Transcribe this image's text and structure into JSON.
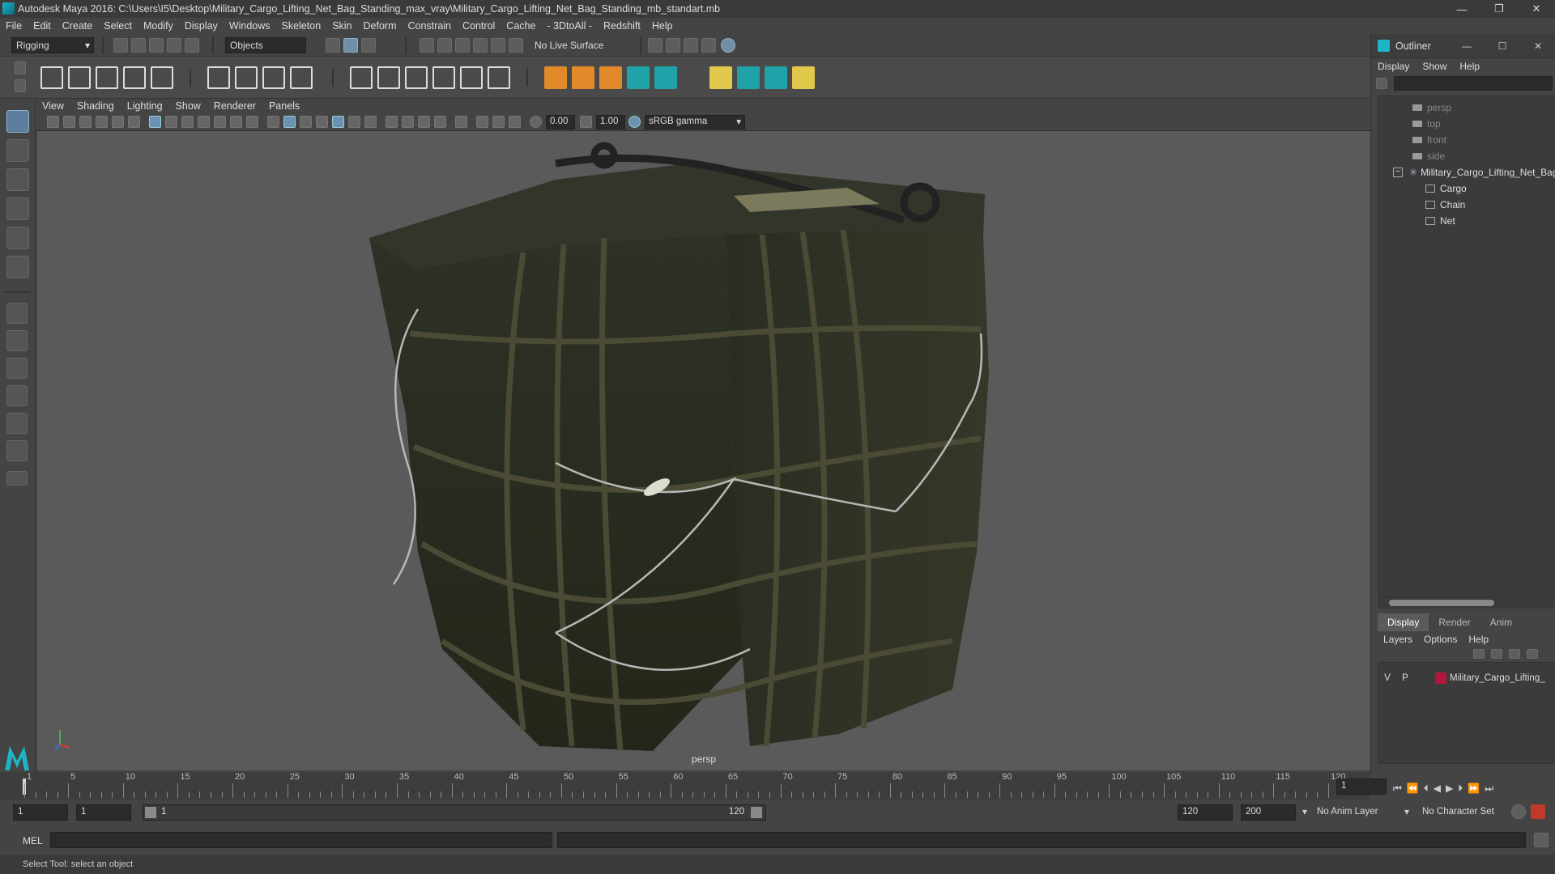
{
  "window": {
    "title": "Autodesk Maya 2016: C:\\Users\\I5\\Desktop\\Military_Cargo_Lifting_Net_Bag_Standing_max_vray\\Military_Cargo_Lifting_Net_Bag_Standing_mb_standart.mb"
  },
  "menubar": [
    "File",
    "Edit",
    "Create",
    "Select",
    "Modify",
    "Display",
    "Windows",
    "Skeleton",
    "Skin",
    "Deform",
    "Constrain",
    "Control",
    "Cache",
    "- 3DtoAll -",
    "Redshift",
    "Help"
  ],
  "status_line": {
    "mode": "Rigging",
    "select_mode": "Objects",
    "live_surface": "No Live Surface"
  },
  "viewport": {
    "menu": [
      "View",
      "Shading",
      "Lighting",
      "Show",
      "Renderer",
      "Panels"
    ],
    "exposure": "0.00",
    "gamma": "1.00",
    "color_space": "sRGB gamma",
    "camera_label": "persp"
  },
  "outliner": {
    "title": "Outliner",
    "menu": [
      "Display",
      "Show",
      "Help"
    ],
    "items": [
      {
        "label": "persp",
        "type": "camera"
      },
      {
        "label": "top",
        "type": "camera"
      },
      {
        "label": "front",
        "type": "camera"
      },
      {
        "label": "side",
        "type": "camera"
      },
      {
        "label": "Military_Cargo_Lifting_Net_Bag",
        "type": "group"
      },
      {
        "label": "Cargo",
        "type": "mesh"
      },
      {
        "label": "Chain",
        "type": "mesh"
      },
      {
        "label": "Net",
        "type": "mesh"
      }
    ]
  },
  "layer_editor": {
    "tabs": [
      "Display",
      "Render",
      "Anim"
    ],
    "menu": [
      "Layers",
      "Options",
      "Help"
    ],
    "layer": {
      "v": "V",
      "p": "P",
      "name": "Military_Cargo_Lifting_",
      "color": "#b0173d"
    }
  },
  "timeline": {
    "labels": [
      "1",
      "5",
      "10",
      "15",
      "20",
      "25",
      "30",
      "35",
      "40",
      "45",
      "50",
      "55",
      "60",
      "65",
      "70",
      "75",
      "80",
      "85",
      "90",
      "95",
      "100",
      "105",
      "110",
      "115",
      "120"
    ],
    "current_frame": "1"
  },
  "range": {
    "start": "1",
    "playback_start": "1",
    "slider_start": "1",
    "slider_end": "120",
    "playback_end": "120",
    "end": "200",
    "anim_layer": "No Anim Layer",
    "character_set": "No Character Set"
  },
  "command": {
    "lang": "MEL"
  },
  "help": {
    "text": "Select Tool: select an object"
  }
}
